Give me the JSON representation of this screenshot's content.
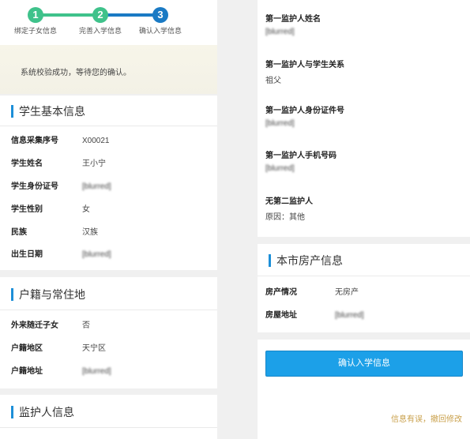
{
  "colors": {
    "accent": "#1d8fd8",
    "step_done": "#3fc28b",
    "step_current": "#1a7ac4",
    "button": "#1ca0e8",
    "link": "#c9a04b"
  },
  "stepper": {
    "steps": [
      {
        "number": "1",
        "label": "绑定子女信息"
      },
      {
        "number": "2",
        "label": "完善入学信息"
      },
      {
        "number": "3",
        "label": "确认入学信息"
      }
    ]
  },
  "notice": "系统校验成功，等待您的确认。",
  "student": {
    "title": "学生基本信息",
    "rows": [
      {
        "label": "信息采集序号",
        "value": "X00021"
      },
      {
        "label": "学生姓名",
        "value": "王小宁"
      },
      {
        "label": "学生身份证号",
        "value": "[blurred]"
      },
      {
        "label": "学生性别",
        "value": "女"
      },
      {
        "label": "民族",
        "value": "汉族"
      },
      {
        "label": "出生日期",
        "value": "[blurred]"
      }
    ]
  },
  "residence": {
    "title": "户籍与常住地",
    "rows": [
      {
        "label": "外来随迁子女",
        "value": "否"
      },
      {
        "label": "户籍地区",
        "value": "天宁区"
      },
      {
        "label": "户籍地址",
        "value": "[blurred]"
      }
    ]
  },
  "guardian_section": {
    "title": "监护人信息"
  },
  "guardian": {
    "name_label": "第一监护人姓名",
    "name_value": "[blurred]",
    "relation_label": "第一监护人与学生关系",
    "relation_value": "祖父",
    "id_label": "第一监护人身份证件号",
    "id_value": "[blurred]",
    "phone_label": "第一监护人手机号码",
    "phone_value": "[blurred]",
    "second_label": "无第二监护人",
    "second_value": "原因：其他"
  },
  "property": {
    "title": "本市房产信息",
    "rows": [
      {
        "label": "房产情况",
        "value": "无房产"
      },
      {
        "label": "房屋地址",
        "value": "[blurred]"
      }
    ]
  },
  "actions": {
    "confirm": "确认入学信息",
    "undo": "信息有误，撤回修改"
  }
}
